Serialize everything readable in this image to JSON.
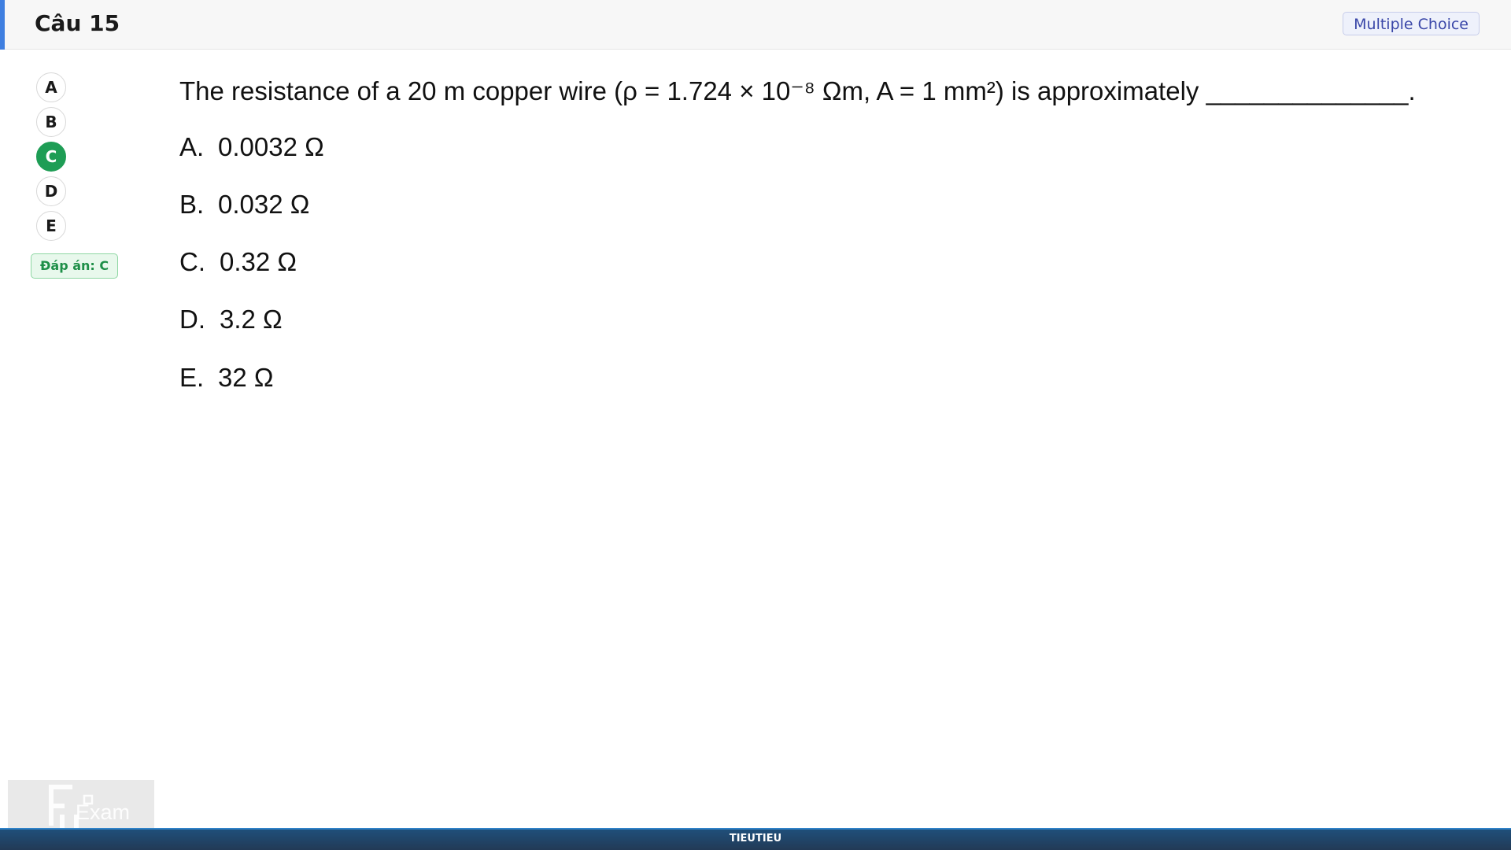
{
  "header": {
    "title": "Câu 15",
    "question_type": "Multiple Choice",
    "accent_color": "#3f7fe0"
  },
  "choices": [
    {
      "letter": "A",
      "selected": false
    },
    {
      "letter": "B",
      "selected": false
    },
    {
      "letter": "C",
      "selected": true
    },
    {
      "letter": "D",
      "selected": false
    },
    {
      "letter": "E",
      "selected": false
    }
  ],
  "selected_color": "#1e9d55",
  "answer_badge": "Đáp án: C",
  "question": {
    "text": "The resistance of a 20 m copper wire (ρ = 1.724 × 10⁻⁸ Ωm, A = 1 mm²) is approximately ______________.",
    "options": [
      {
        "letter": "A.",
        "text": "0.0032 Ω"
      },
      {
        "letter": "B.",
        "text": "0.032 Ω"
      },
      {
        "letter": "C.",
        "text": "0.32 Ω"
      },
      {
        "letter": "D.",
        "text": "3.2 Ω"
      },
      {
        "letter": "E.",
        "text": "32 Ω"
      }
    ]
  },
  "logo": {
    "text": "Exam",
    "icon": "fexam-logo-icon"
  },
  "footer": {
    "text": "TIEUTIEU"
  }
}
